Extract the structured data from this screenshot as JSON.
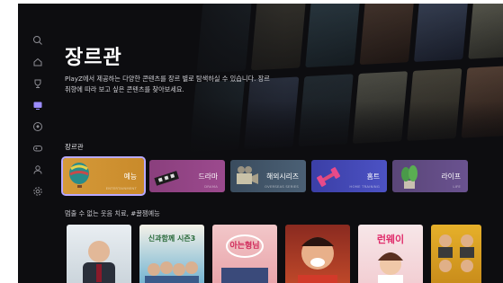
{
  "header": {
    "title": "장르관",
    "description": "PlayZ에서 제공하는 다양한 콘텐츠를 장르 별로 탐색하실 수 있습니다. 장르 취향에 따라 보고 싶은 콘텐츠를 찾아보세요."
  },
  "sidebar": {
    "items": [
      {
        "icon": "search-icon"
      },
      {
        "icon": "home-icon"
      },
      {
        "icon": "trophy-icon"
      },
      {
        "icon": "tv-icon",
        "active": true
      },
      {
        "icon": "football-icon"
      },
      {
        "icon": "gamepad-icon"
      },
      {
        "icon": "user-icon"
      },
      {
        "icon": "gear-icon"
      }
    ]
  },
  "genre_section": {
    "label": "장르관",
    "items": [
      {
        "label": "예능",
        "sub": "ENTERTAINMENT",
        "selected": true
      },
      {
        "label": "드라마",
        "sub": "DRAMA"
      },
      {
        "label": "해외시리즈",
        "sub": "OVERSEAS SERIES"
      },
      {
        "label": "홈트",
        "sub": "HOME TRAINING"
      },
      {
        "label": "라이프",
        "sub": "LIFE"
      }
    ]
  },
  "row": {
    "label": "멈출 수 없는 웃음 치료, #꿀잼예능",
    "posters": [
      {
        "title": ""
      },
      {
        "title": "신과함께 시즌3"
      },
      {
        "title": "아는형님"
      },
      {
        "title": ""
      },
      {
        "title": "런웨이"
      },
      {
        "title": ""
      }
    ]
  },
  "colors": {
    "accent_outline": "#b8a9ff",
    "background": "#0d0d10"
  }
}
